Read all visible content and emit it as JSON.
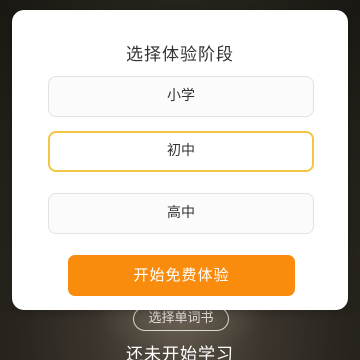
{
  "dialog": {
    "title": "选择体验阶段",
    "options": [
      {
        "label": "小学",
        "selected": false
      },
      {
        "label": "初中",
        "selected": true
      },
      {
        "label": "高中",
        "selected": false
      }
    ],
    "start_label": "开始免费体验"
  },
  "background": {
    "word_button_label": "选择单词书",
    "status_text": "还未开始学习"
  },
  "colors": {
    "accent": "#fa8c0d",
    "selected_border": "#f3c544"
  }
}
